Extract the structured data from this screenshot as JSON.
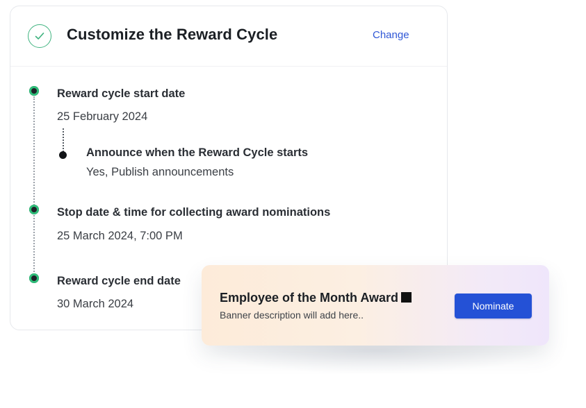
{
  "card": {
    "title": "Customize the Reward Cycle",
    "change_label": "Change"
  },
  "timeline": {
    "start": {
      "label": "Reward cycle start date",
      "value": "25 February 2024"
    },
    "announce": {
      "label": "Announce when the Reward Cycle starts",
      "value": "Yes, Publish announcements"
    },
    "stop": {
      "label": "Stop date & time for collecting award nominations",
      "value": "25 March 2024, 7:00 PM"
    },
    "end": {
      "label": "Reward cycle end date",
      "value": "30 March 2024"
    }
  },
  "banner": {
    "title": "Employee of the Month Award",
    "description": "Banner description will add here..",
    "button_label": "Nominate"
  },
  "icons": {
    "check": "check-icon",
    "timeline_dot": "timeline-dot-icon"
  },
  "colors": {
    "accent_green": "#3fb37f",
    "link_blue": "#2f57d6",
    "button_blue": "#2451d6"
  }
}
